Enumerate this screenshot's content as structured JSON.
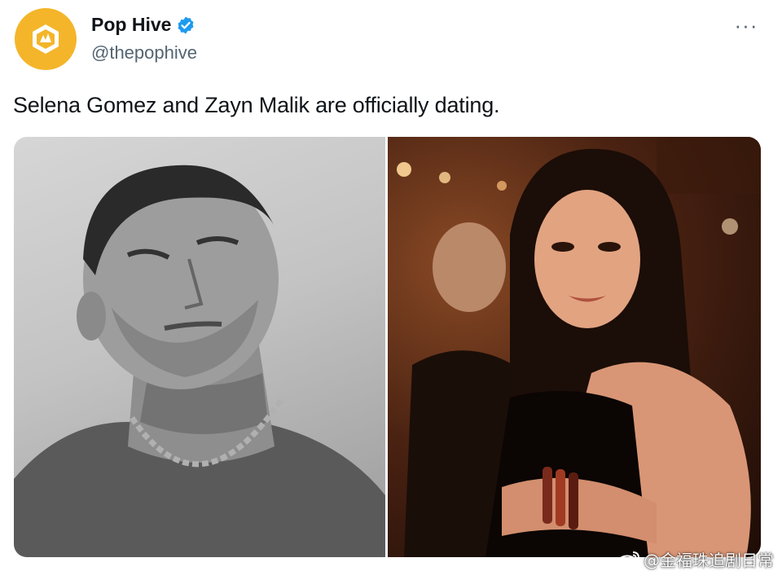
{
  "author": {
    "display_name": "Pop Hive",
    "handle": "@thepophive",
    "verified": true,
    "avatar_icon": "pophive-logo-icon",
    "avatar_color": "#f4b52a"
  },
  "more_menu_icon": "more-horizontal-icon",
  "more_label": "···",
  "tweet": {
    "text": "Selena Gomez and Zayn Malik are officially dating."
  },
  "media": [
    {
      "kind": "photo",
      "tone": "black-and-white",
      "subject": "man-portrait"
    },
    {
      "kind": "photo",
      "tone": "warm-color",
      "subject": "woman-portrait"
    }
  ],
  "watermark": {
    "text": "@金福珠追剧日常",
    "icon": "weibo-icon"
  },
  "colors": {
    "text_primary": "#0f1419",
    "text_secondary": "#536471",
    "verified_blue": "#1d9bf0"
  }
}
